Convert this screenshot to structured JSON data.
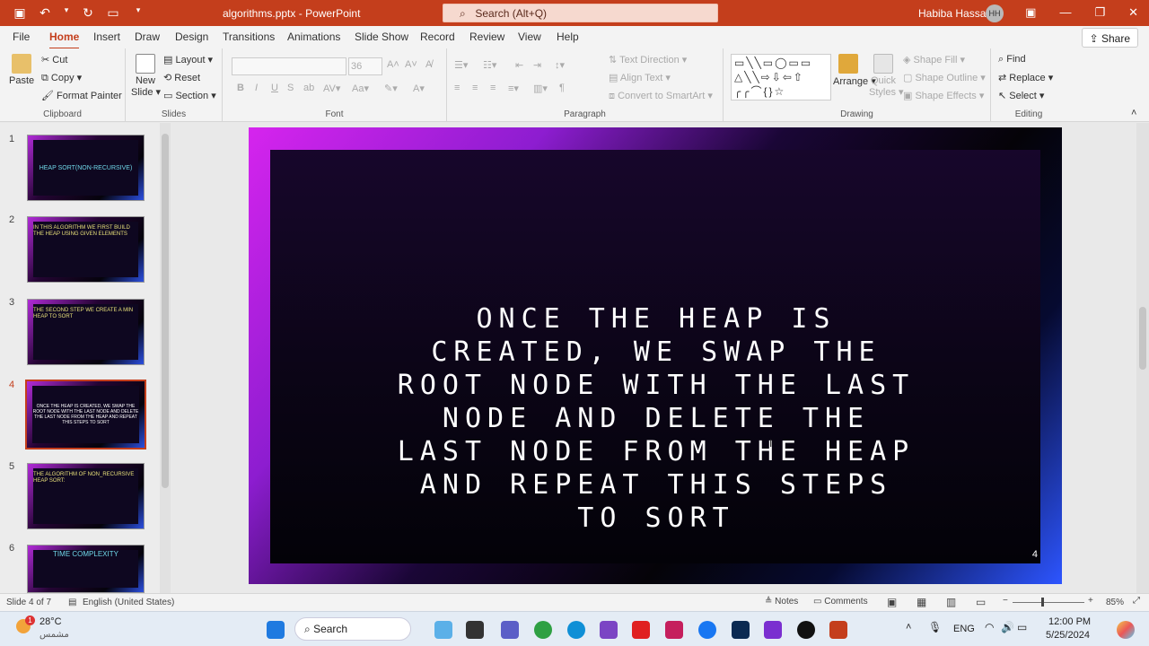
{
  "titlebar": {
    "file_name": "algorithms.pptx",
    "app_sep": "-",
    "app_name": "PowerPoint",
    "search_placeholder": "Search (Alt+Q)",
    "user_name": "Habiba Hassan",
    "user_initials": "HH"
  },
  "menu_tabs": [
    "File",
    "Home",
    "Insert",
    "Draw",
    "Design",
    "Transitions",
    "Animations",
    "Slide Show",
    "Record",
    "Review",
    "View",
    "Help"
  ],
  "share_label": "Share",
  "ribbon": {
    "clipboard": {
      "paste": "Paste",
      "cut": "Cut",
      "copy": "Copy",
      "format_painter": "Format Painter",
      "label": "Clipboard"
    },
    "slides": {
      "new_slide_1": "New",
      "new_slide_2": "Slide",
      "layout": "Layout",
      "reset": "Reset",
      "section": "Section",
      "label": "Slides"
    },
    "font": {
      "size": "36",
      "label": "Font",
      "bold": "B",
      "italic": "I",
      "underline": "U",
      "strike": "S"
    },
    "paragraph": {
      "text_direction": "Text Direction",
      "align_text": "Align Text",
      "convert_smartart": "Convert to SmartArt",
      "label": "Paragraph"
    },
    "drawing": {
      "arrange": "Arrange",
      "quick_styles_1": "Quick",
      "quick_styles_2": "Styles",
      "shape_fill": "Shape Fill",
      "shape_outline": "Shape Outline",
      "shape_effects": "Shape Effects",
      "label": "Drawing"
    },
    "editing": {
      "find": "Find",
      "replace": "Replace",
      "select": "Select",
      "label": "Editing"
    }
  },
  "thumbnails": [
    {
      "num": "1",
      "text": "HEAP SORT(NON-RECURSIVE)"
    },
    {
      "num": "2",
      "text": "IN THIS ALGORITHM WE FIRST BUILD THE HEAP USING GIVEN ELEMENTS"
    },
    {
      "num": "3",
      "text": "THE SECOND STEP WE CREATE A MIN HEAP TO SORT"
    },
    {
      "num": "4",
      "text": "ONCE THE HEAP IS CREATED, WE SWAP THE ROOT NODE WITH THE LAST NODE AND DELETE THE LAST NODE FROM THE HEAP AND REPEAT THIS STEPS TO SORT"
    },
    {
      "num": "5",
      "text": "THE ALGORITHM OF NON_RECURSIVE HEAP SORT:"
    },
    {
      "num": "6",
      "text": "TIME COMPLEXITY"
    }
  ],
  "slide": {
    "text": "ONCE THE HEAP IS CREATED, WE SWAP THE ROOT NODE WITH THE LAST NODE AND DELETE THE LAST NODE FROM THE HEAP AND REPEAT THIS STEPS TO SORT",
    "number": "4"
  },
  "status": {
    "slide_of": "Slide 4 of 7",
    "language": "English (United States)",
    "notes": "Notes",
    "comments": "Comments",
    "zoom": "85%"
  },
  "taskbar": {
    "weather_temp": "28°C",
    "weather_desc": "مشمس",
    "search": "Search",
    "lang": "ENG",
    "time": "12:00 PM",
    "date": "5/25/2024",
    "notif_badge": "1"
  },
  "colors": {
    "accent": "#c43e1c",
    "slide_magenta": "#d624ee",
    "slide_blue": "#2d55ff"
  }
}
